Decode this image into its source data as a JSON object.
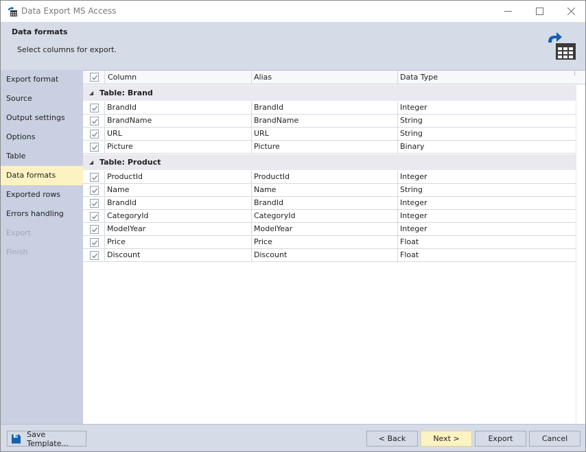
{
  "window": {
    "title": "Data Export MS Access",
    "controls": {
      "minimize": "minimize",
      "maximize": "maximize",
      "close": "close"
    }
  },
  "header": {
    "title": "Data formats",
    "subtitle": "Select columns for export.",
    "icon": "export-table-icon"
  },
  "sidebar": {
    "items": [
      {
        "label": "Export format",
        "state": "normal"
      },
      {
        "label": "Source",
        "state": "normal"
      },
      {
        "label": "Output settings",
        "state": "normal"
      },
      {
        "label": "Options",
        "state": "normal"
      },
      {
        "label": "Table",
        "state": "normal"
      },
      {
        "label": "Data formats",
        "state": "active"
      },
      {
        "label": "Exported rows",
        "state": "normal"
      },
      {
        "label": "Errors handling",
        "state": "normal"
      },
      {
        "label": "Export",
        "state": "disabled"
      },
      {
        "label": "Finish",
        "state": "disabled"
      }
    ]
  },
  "grid": {
    "select_all_checked": true,
    "columns": [
      "Column",
      "Alias",
      "Data Type"
    ],
    "groups": [
      {
        "label": "Table: Brand",
        "expanded": true,
        "rows": [
          {
            "checked": true,
            "column": "BrandId",
            "alias": "BrandId",
            "type": "Integer"
          },
          {
            "checked": true,
            "column": "BrandName",
            "alias": "BrandName",
            "type": "String"
          },
          {
            "checked": true,
            "column": "URL",
            "alias": "URL",
            "type": "String"
          },
          {
            "checked": true,
            "column": "Picture",
            "alias": "Picture",
            "type": "Binary"
          }
        ]
      },
      {
        "label": "Table: Product",
        "expanded": true,
        "rows": [
          {
            "checked": true,
            "column": "ProductId",
            "alias": "ProductId",
            "type": "Integer"
          },
          {
            "checked": true,
            "column": "Name",
            "alias": "Name",
            "type": "String"
          },
          {
            "checked": true,
            "column": "BrandId",
            "alias": "BrandId",
            "type": "Integer"
          },
          {
            "checked": true,
            "column": "CategoryId",
            "alias": "CategoryId",
            "type": "Integer"
          },
          {
            "checked": true,
            "column": "ModelYear",
            "alias": "ModelYear",
            "type": "Integer"
          },
          {
            "checked": true,
            "column": "Price",
            "alias": "Price",
            "type": "Float"
          },
          {
            "checked": true,
            "column": "Discount",
            "alias": "Discount",
            "type": "Float"
          }
        ]
      }
    ]
  },
  "footer": {
    "save_template": "Save Template...",
    "back": "< Back",
    "next": "Next >",
    "export": "Export",
    "cancel": "Cancel"
  },
  "colors": {
    "accent_blue": "#1560b0",
    "active_highlight": "#fdf3c2",
    "panel_bg": "#d5dbe7",
    "sidebar_bg": "#c9d0e1"
  }
}
